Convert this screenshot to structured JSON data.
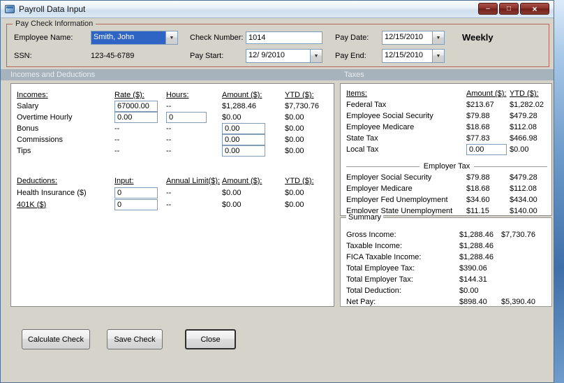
{
  "window": {
    "title": "Payroll Data Input"
  },
  "icons": {
    "minimize": "–",
    "maximize": "□",
    "close": "×",
    "dropdown": "▼"
  },
  "colors": {
    "selection_blue": "#2f63c4",
    "paycheck_border": "#b4665c",
    "band_background": "#a6b2bc",
    "caption_button_red": "#8c342c",
    "body_background": "#d6d3cb"
  },
  "paycheck": {
    "legend": "Pay Check Information",
    "frequency": "Weekly",
    "fields": {
      "employee_name": {
        "label": "Employee Name:",
        "value": "Smith, John"
      },
      "ssn": {
        "label": "SSN:",
        "value": "123-45-6789"
      },
      "check_number": {
        "label": "Check Number:",
        "value": "1014"
      },
      "pay_start": {
        "label": "Pay Start:",
        "value": "12/ 9/2010"
      },
      "pay_date": {
        "label": "Pay Date:",
        "value": "12/15/2010"
      },
      "pay_end": {
        "label": "Pay End:",
        "value": "12/15/2010"
      }
    }
  },
  "section_headers": {
    "left": "Incomes and Deductions",
    "right": "Taxes"
  },
  "incomes": {
    "title": "Incomes:",
    "columns": {
      "rate": "Rate ($):",
      "hours": "Hours:",
      "amount": "Amount ($):",
      "ytd": "YTD ($):"
    },
    "rows": [
      {
        "label": "Salary",
        "rate": "67000.00",
        "hours": "--",
        "amount": "$1,288.46",
        "ytd": "$7,730.76"
      },
      {
        "label": "Overtime Hourly",
        "rate": "0.00",
        "hours": "0",
        "amount": "$0.00",
        "ytd": "$0.00"
      },
      {
        "label": "Bonus",
        "rate": "--",
        "hours": "--",
        "amount": "0.00",
        "ytd": "$0.00"
      },
      {
        "label": "Commissions",
        "rate": "--",
        "hours": "--",
        "amount": "0.00",
        "ytd": "$0.00"
      },
      {
        "label": "Tips",
        "rate": "--",
        "hours": "--",
        "amount": "0.00",
        "ytd": "$0.00"
      }
    ]
  },
  "deductions": {
    "title": "Deductions:",
    "columns": {
      "input": "Input:",
      "limit": "Annual Limit($):",
      "amount": "Amount ($):",
      "ytd": "YTD ($):"
    },
    "rows": [
      {
        "label": "Health Insurance  ($)",
        "input": "0",
        "limit": "--",
        "amount": "$0.00",
        "ytd": "$0.00"
      },
      {
        "label": "401K  ($)",
        "input": "0",
        "limit": "--",
        "amount": "$0.00",
        "ytd": "$0.00"
      }
    ]
  },
  "taxes": {
    "columns": {
      "items": "Items:",
      "amount": "Amount ($):",
      "ytd": "YTD ($):"
    },
    "employee_rows": [
      {
        "label": "Federal Tax",
        "amount": "$213.67",
        "ytd": "$1,282.02"
      },
      {
        "label": "Employee Social Security",
        "amount": "$79.88",
        "ytd": "$479.28"
      },
      {
        "label": "Employee Medicare",
        "amount": "$18.68",
        "ytd": "$112.08"
      },
      {
        "label": "State Tax",
        "amount": "$77.83",
        "ytd": "$466.98"
      },
      {
        "label": "Local Tax",
        "amount": "0.00",
        "ytd": "$0.00"
      }
    ],
    "employer_header": "Employer Tax",
    "employer_rows": [
      {
        "label": "Employer Social Security",
        "amount": "$79.88",
        "ytd": "$479.28"
      },
      {
        "label": "Employer Medicare",
        "amount": "$18.68",
        "ytd": "$112.08"
      },
      {
        "label": "Employer Fed Unemployment",
        "amount": "$34.60",
        "ytd": "$434.00"
      },
      {
        "label": "Employer State Unemployment",
        "amount": "$11.15",
        "ytd": "$140.00"
      }
    ]
  },
  "summary": {
    "legend": "Summary",
    "rows": [
      {
        "label": "Gross Income:",
        "amount": "$1,288.46",
        "ytd": "$7,730.76"
      },
      {
        "label": "Taxable Income:",
        "amount": "$1,288.46",
        "ytd": ""
      },
      {
        "label": "FICA Taxable Income:",
        "amount": "$1,288.46",
        "ytd": ""
      },
      {
        "label": "Total Employee Tax:",
        "amount": "$390.06",
        "ytd": ""
      },
      {
        "label": "Total Employer Tax:",
        "amount": "$144.31",
        "ytd": ""
      },
      {
        "label": "Total Deduction:",
        "amount": "$0.00",
        "ytd": ""
      },
      {
        "label": "Net Pay:",
        "amount": "$898.40",
        "ytd": "$5,390.40"
      }
    ]
  },
  "buttons": {
    "calculate": "Calculate Check",
    "save": "Save Check",
    "close": "Close"
  }
}
